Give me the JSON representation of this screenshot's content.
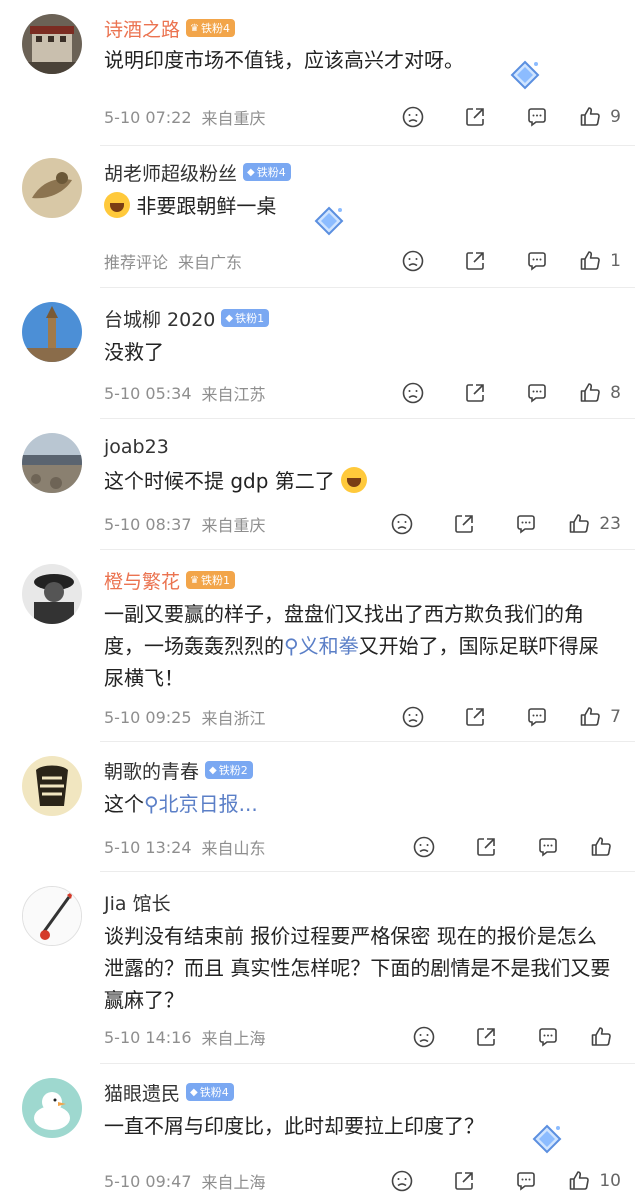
{
  "icons": [
    "dislike-icon",
    "share-icon",
    "comment-icon",
    "like-icon",
    "search-icon",
    "diamond-icon",
    "crown-icon"
  ],
  "colors": {
    "name_orange": "#eb7350",
    "topic_blue": "#5b7fc7",
    "meta_gray": "#8e8e8e",
    "badge_blue": "#7aa8f2",
    "badge_gold": "#f2a54a"
  },
  "comments": [
    {
      "name": "诗酒之路",
      "badge": "铁粉4",
      "text": "说明印度市场不值钱，应该高兴才对呀。",
      "time": "5-10 07:22",
      "location": "来自重庆",
      "likes": "9"
    },
    {
      "name": "胡老师超级粉丝",
      "badge": "铁粉4",
      "text": "非要跟朝鲜一桌",
      "time": "推荐评论",
      "location": "来自广东",
      "likes": "1"
    },
    {
      "name": "台城柳 2020",
      "badge": "铁粉1",
      "text": "没救了",
      "time": "5-10 05:34",
      "location": "来自江苏",
      "likes": "8"
    },
    {
      "name": "joab23",
      "badge": "",
      "text": "这个时候不提 gdp 第二了",
      "time": "5-10 08:37",
      "location": "来自重庆",
      "likes": "23"
    },
    {
      "name": "橙与繁花",
      "badge": "铁粉1",
      "text_before": "一副又要赢的样子，盘盘们又找出了西方欺负我们的角度，一场轰轰烈烈的",
      "topic": "义和拳",
      "text_after": "又开始了，国际足联吓得屎尿横飞！",
      "time": "5-10 09:25",
      "location": "来自浙江",
      "likes": "7"
    },
    {
      "name": "朝歌的青春",
      "badge": "铁粉2",
      "text_before": "这个",
      "topic": "北京日报...",
      "time": "5-10 13:24",
      "location": "来自山东",
      "likes": ""
    },
    {
      "name": "Jia 馆长",
      "badge": "",
      "text": "谈判没有结束前 报价过程要严格保密 现在的报价是怎么泄露的？而且 真实性怎样呢？下面的剧情是不是我们又要赢麻了？",
      "time": "5-10 14:16",
      "location": "来自上海",
      "likes": ""
    },
    {
      "name": "猫眼遗民",
      "badge": "铁粉4",
      "text": "一直不屑与印度比，此时却要拉上印度了？",
      "time": "5-10 09:47",
      "location": "来自上海",
      "likes": "10"
    }
  ]
}
